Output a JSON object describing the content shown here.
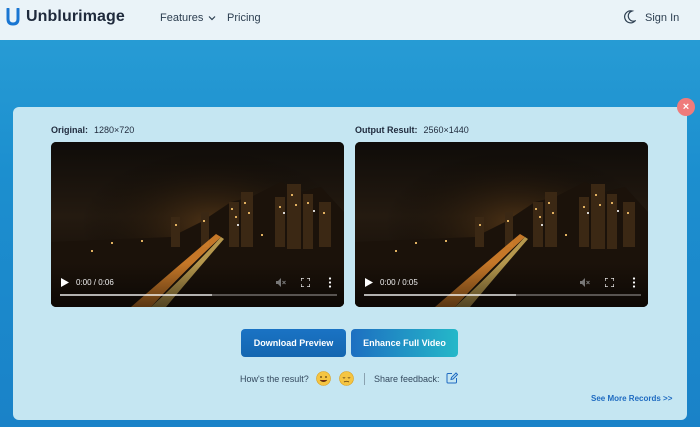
{
  "header": {
    "brand": "Unblurimage",
    "nav": [
      {
        "label": "Features"
      },
      {
        "label": "Pricing"
      }
    ],
    "signin_label": "Sign In"
  },
  "comparison": {
    "original": {
      "label": "Original:",
      "resolution": "1280×720",
      "time": "0:00 / 0:06",
      "progress": 0.55
    },
    "output": {
      "label": "Output Result:",
      "resolution": "2560×1440",
      "time": "0:00 / 0:05",
      "progress": 0.55
    }
  },
  "actions": {
    "download_label": "Download Preview",
    "enhance_label": "Enhance Full Video"
  },
  "feedback": {
    "question": "How's the result?",
    "share_label": "Share feedback:"
  },
  "see_more_label": "See More Records >>",
  "colors": {
    "background": "#1c8fcf",
    "panel": "#c5e6f2",
    "accent": "#1a73c4",
    "link": "#1f6bc1",
    "close": "#ef7b7b"
  }
}
